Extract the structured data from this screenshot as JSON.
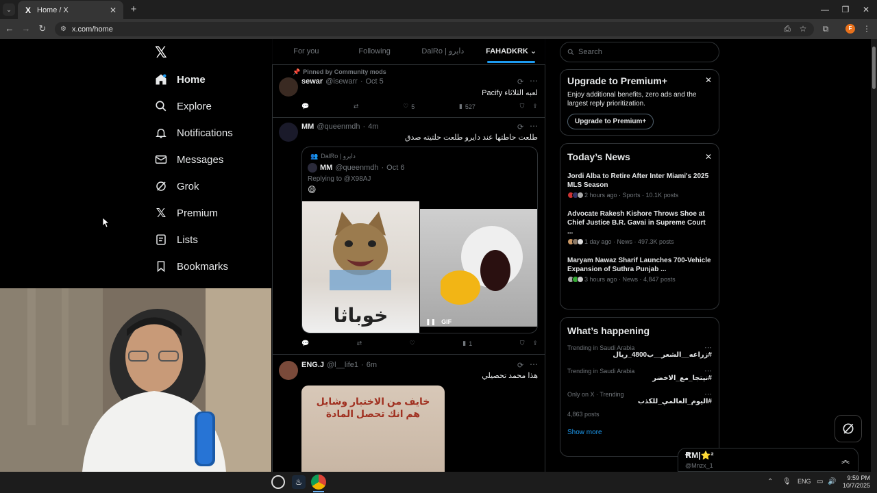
{
  "browser": {
    "tab_title": "Home / X",
    "url": "x.com/home",
    "tab_favicon": "X"
  },
  "nav": {
    "items": [
      {
        "label": "Home",
        "icon": "home-icon"
      },
      {
        "label": "Explore",
        "icon": "search-icon"
      },
      {
        "label": "Notifications",
        "icon": "bell-icon"
      },
      {
        "label": "Messages",
        "icon": "envelope-icon"
      },
      {
        "label": "Grok",
        "icon": "grok-icon"
      },
      {
        "label": "Premium",
        "icon": "x-icon"
      },
      {
        "label": "Lists",
        "icon": "list-icon"
      },
      {
        "label": "Bookmarks",
        "icon": "bookmark-icon"
      }
    ]
  },
  "feed_tabs": [
    "For you",
    "Following",
    "DalRo | دايرو",
    "FAHADKRK"
  ],
  "posts": [
    {
      "pinned_label": "Pinned by Community mods",
      "name": "sewar",
      "handle": "@isewarr",
      "time": "Oct 5",
      "text": "لعبه الثلاثاء Pacify",
      "likes": "5",
      "views": "527"
    },
    {
      "name": "MM",
      "handle": "@queenmdh",
      "time": "4m",
      "text": "طلعت حاطتها عند دايرو طلعت حلتيته صدق",
      "quote": {
        "community": "DalRo | دايرو",
        "name": "MM",
        "handle": "@queenmdh",
        "time": "Oct 6",
        "replying": "Replying to @X98AJ",
        "emoji": "😄",
        "image_caption": "خوباثا ههههه",
        "gif_label": "GIF"
      },
      "views": "1"
    },
    {
      "name": "ENG.J",
      "handle": "@l__life1",
      "time": "6m",
      "text": "هذا محمد تحصيلي",
      "image_caption": "خايف من الاختبار وشايل هم انك تحصل المادة"
    }
  ],
  "right": {
    "search_placeholder": "Search",
    "premium": {
      "title": "Upgrade to Premium+",
      "body": "Enjoy additional benefits, zero ads and the largest reply prioritization.",
      "button": "Upgrade to Premium+"
    },
    "news": {
      "title": "Today’s News",
      "items": [
        {
          "headline": "Jordi Alba to Retire After Inter Miami's 2025 MLS Season",
          "meta": "2 hours ago · Sports · 10.1K posts"
        },
        {
          "headline": "Advocate Rakesh Kishore Throws Shoe at Chief Justice B.R. Gavai in Supreme Court ...",
          "meta": "1 day ago · News · 497.3K posts"
        },
        {
          "headline": "Maryam Nawaz Sharif Launches 700-Vehicle Expansion of Suthra Punjab ...",
          "meta": "3 hours ago · News · 4,847 posts"
        }
      ]
    },
    "happening": {
      "title": "What’s happening",
      "items": [
        {
          "context": "Trending in Saudi Arabia",
          "topic": "#زراعه__الشعر__ب4800_ريال",
          "posts": ""
        },
        {
          "context": "Trending in Saudi Arabia",
          "topic": "#نيتجا_مع_الاخضر",
          "posts": ""
        },
        {
          "context": "Only on X · Trending",
          "topic": "#اليوم_العالمي_للكذب",
          "posts": "4,863 posts"
        }
      ],
      "show_more": "Show more"
    },
    "messages_drawer": {
      "title": "ꞦM|⭐²",
      "handle": "@Mnzx_1"
    }
  },
  "taskbar": {
    "lang": "ENG",
    "time": "9:59 PM",
    "date": "10/7/2025"
  },
  "colors": {
    "accent": "#1d9bf0",
    "bg": "#000000",
    "border": "#2f3336",
    "muted": "#71767b"
  }
}
